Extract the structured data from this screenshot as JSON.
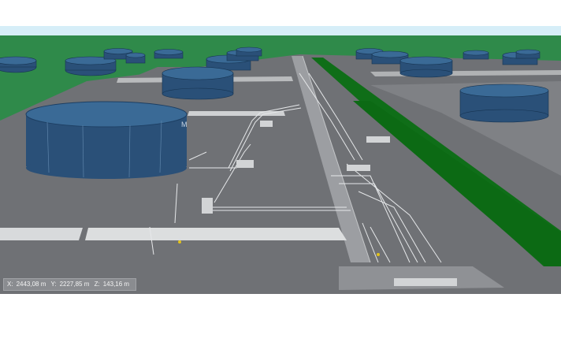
{
  "scene": {
    "description_visible": "",
    "colors": {
      "sky": "#d6eef8",
      "grass": "#2f8a4a",
      "ground": "#6f7175",
      "paved": "#8f9195",
      "tank": "#2a5078",
      "green_strip": "#0f6e18",
      "pipes": "#e6e8ea"
    },
    "main_tank_label": "M"
  },
  "coordinates": {
    "x_label": "X:",
    "x_value": "2443,08 m",
    "y_label": "Y:",
    "y_value": "2227,85 m",
    "z_label": "Z:",
    "z_value": "143,16 m"
  }
}
